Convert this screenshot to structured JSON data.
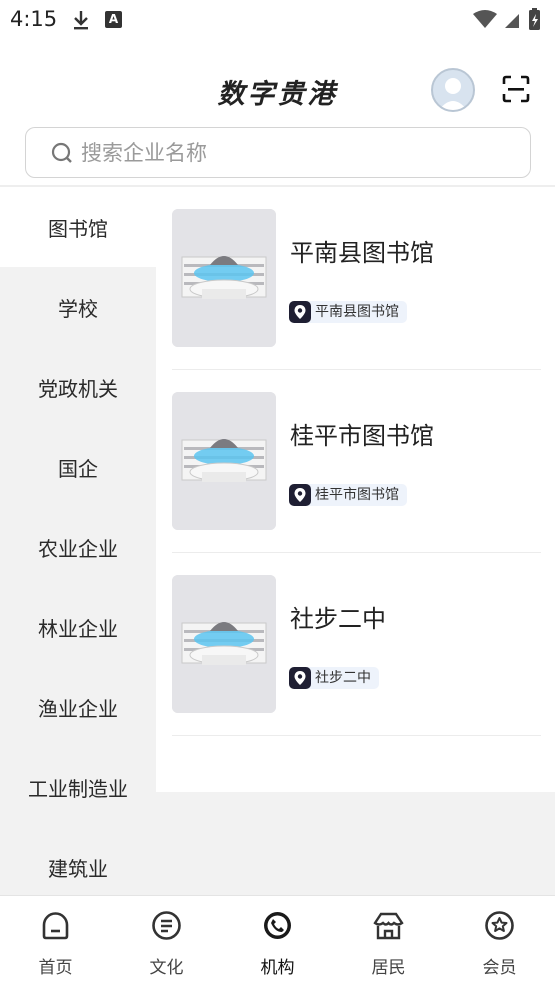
{
  "status": {
    "time": "4:15",
    "icon_download": "download-icon",
    "icon_a": "A"
  },
  "header": {
    "title": "数字贵港"
  },
  "search": {
    "placeholder": "搜索企业名称",
    "value": ""
  },
  "sidebar": {
    "items": [
      {
        "label": "图书馆",
        "active": true
      },
      {
        "label": "学校"
      },
      {
        "label": "党政机关"
      },
      {
        "label": "国企"
      },
      {
        "label": "农业企业"
      },
      {
        "label": "林业企业"
      },
      {
        "label": "渔业企业"
      },
      {
        "label": "工业制造业"
      },
      {
        "label": "建筑业"
      }
    ]
  },
  "list": {
    "items": [
      {
        "title": "平南县图书馆",
        "tag": "平南县图书馆"
      },
      {
        "title": "桂平市图书馆",
        "tag": "桂平市图书馆"
      },
      {
        "title": "社步二中",
        "tag": "社步二中"
      }
    ]
  },
  "tabbar": {
    "tabs": [
      {
        "label": "首页",
        "icon": "home-icon"
      },
      {
        "label": "文化",
        "icon": "culture-icon"
      },
      {
        "label": "机构",
        "icon": "institution-icon",
        "active": true
      },
      {
        "label": "居民",
        "icon": "resident-icon"
      },
      {
        "label": "会员",
        "icon": "member-icon"
      }
    ]
  },
  "colors": {
    "accent_tag_bg": "#eef3fb",
    "sidebar_bg": "#f2f2f2",
    "tag_icon": "#1f1f33"
  }
}
